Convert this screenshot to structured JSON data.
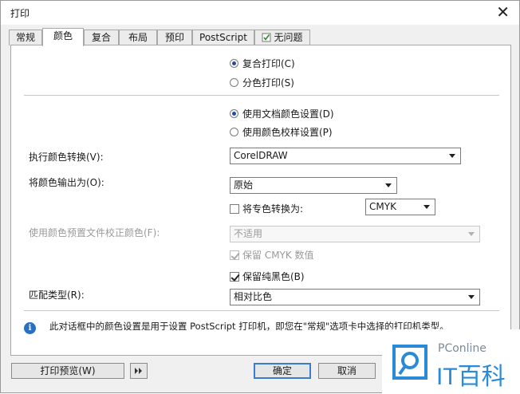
{
  "window": {
    "title": "打印"
  },
  "tabs": [
    {
      "label": "常规"
    },
    {
      "label": "颜色"
    },
    {
      "label": "复合"
    },
    {
      "label": "布局"
    },
    {
      "label": "预印"
    },
    {
      "label": "PostScript"
    },
    {
      "label": "无问题"
    }
  ],
  "output_mode": {
    "composite": "复合打印(C)",
    "separations": "分色打印(S)"
  },
  "color_source": {
    "document": "使用文档颜色设置(D)",
    "proof": "使用颜色校样设置(P)"
  },
  "conversion": {
    "label": "执行颜色转换(V):",
    "value": "CorelDRAW"
  },
  "output_color": {
    "label": "将颜色输出为(O):",
    "value": "原始"
  },
  "spot_convert": {
    "label": "将专色转换为:",
    "value": "CMYK"
  },
  "preset": {
    "label": "使用颜色预置文件校正颜色(F):",
    "value": "不适用"
  },
  "preserve_cmyk": {
    "label": "保留 CMYK 数值"
  },
  "preserve_black": {
    "label": "保留纯黑色(B)"
  },
  "rendering": {
    "label": "匹配类型(R):",
    "value": "相对比色"
  },
  "info": {
    "text": "此对话框中的颜色设置是用于设置 PostScript 打印机，即您在\"常规\"选项卡中选择的打印机类型。"
  },
  "buttons": {
    "preview": "打印预览(W)",
    "ok": "确定",
    "cancel": "取消"
  },
  "watermark": {
    "brand": "PConline",
    "cn": "IT百科"
  },
  "colors": {
    "accent": "#1f4ea1",
    "info": "#2a6fc2",
    "watermark": "#2b8ad8"
  }
}
